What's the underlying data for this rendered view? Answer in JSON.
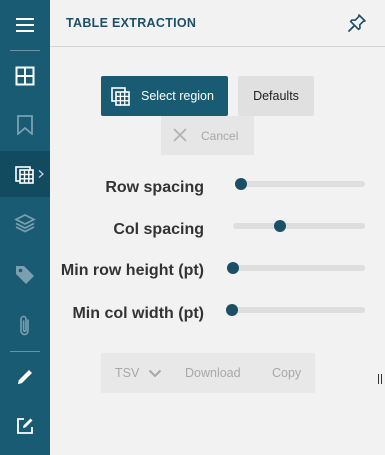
{
  "header": {
    "title": "TABLE EXTRACTION"
  },
  "sidebar": {
    "items": [
      {
        "icon": "menu-icon"
      },
      {
        "icon": "grid-icon"
      },
      {
        "icon": "bookmark-icon"
      },
      {
        "icon": "table-icon",
        "active": true
      },
      {
        "icon": "layers-icon"
      },
      {
        "icon": "tag-icon"
      },
      {
        "icon": "paperclip-icon"
      },
      {
        "icon": "pencil-icon"
      },
      {
        "icon": "edit-icon"
      }
    ]
  },
  "actions": {
    "select_region": "Select region",
    "defaults": "Defaults",
    "cancel": "Cancel"
  },
  "sliders": [
    {
      "label": "Row spacing",
      "value": 0.0
    },
    {
      "label": "Col spacing",
      "value": 0.34
    },
    {
      "label": "Min row height (pt)",
      "value": 0.0
    },
    {
      "label": "Min col width (pt)",
      "value": 0.0
    }
  ],
  "export": {
    "format": "TSV",
    "download": "Download",
    "copy": "Copy"
  },
  "colors": {
    "accent": "#1a5b74",
    "sidebar": "#1a5b74",
    "background": "#f2f2f2",
    "disabled_text": "#a8a8a8"
  }
}
